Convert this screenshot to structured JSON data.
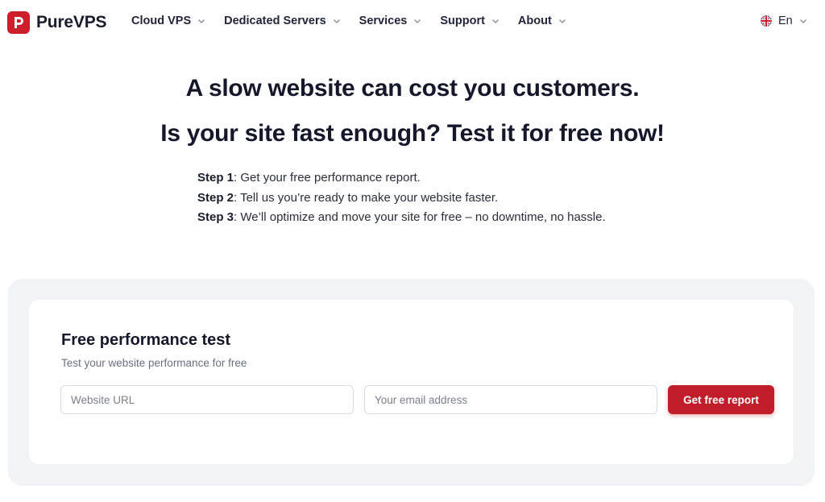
{
  "header": {
    "brand": "PureVPS",
    "nav": [
      {
        "label": "Cloud VPS"
      },
      {
        "label": "Dedicated Servers"
      },
      {
        "label": "Services"
      },
      {
        "label": "Support"
      },
      {
        "label": "About"
      }
    ],
    "language": "En"
  },
  "hero": {
    "headline": "A slow website can cost you customers.",
    "subheadline": "Is your site fast enough? Test it for free now!"
  },
  "steps": [
    {
      "label": "Step 1",
      "text": ": Get your free performance report."
    },
    {
      "label": "Step 2",
      "text": ": Tell us you’re ready to make your website faster."
    },
    {
      "label": "Step 3",
      "text": ": We’ll optimize and move your site for free – no downtime, no hassle."
    }
  ],
  "test_form": {
    "title": "Free performance test",
    "subtitle": "Test your website performance for free",
    "url_placeholder": "Website URL",
    "url_value": "",
    "email_placeholder": "Your email address",
    "email_value": "",
    "submit_label": "Get free report"
  },
  "colors": {
    "brand": "#cc1f2b",
    "cta": "#c21d2a",
    "panel_bg": "#f1f3f7"
  }
}
